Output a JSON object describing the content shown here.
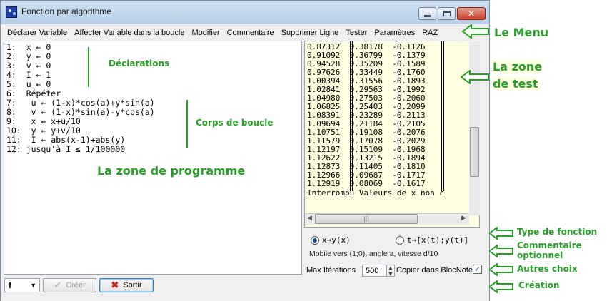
{
  "window": {
    "title": "Fonction par algorithme",
    "close_glyph": "✕"
  },
  "menu": [
    "Déclarer Variable",
    "Affecter Variable dans la boucle",
    "Modifier",
    "Commentaire",
    "Supprimer Ligne",
    "Tester",
    "Paramètres",
    "RAZ"
  ],
  "program": [
    "1:  x ← 0",
    "2:  y ← 0",
    "3:  v ← 0",
    "4:  I ← 1",
    "5:  u ← 0",
    "6:  Répéter",
    "7:   u ← (1-x)*cos(a)+y*sin(a)",
    "8:   v ← (1-x)*sin(a)-y*cos(a)",
    "9:   x ← x+u/10",
    "10:  y ← y+v/10",
    "11:  I ← abs(x-1)+abs(y)",
    "12: jusqu'à I ≤ 1/100000"
  ],
  "test_rows": [
    [
      "0.87312",
      "0.38178",
      "-0.1126"
    ],
    [
      "0.91092",
      "0.36799",
      "-0.1379"
    ],
    [
      "0.94528",
      "0.35209",
      "-0.1589"
    ],
    [
      "0.97626",
      "0.33449",
      "-0.1760"
    ],
    [
      "1.00394",
      "0.31556",
      "-0.1893"
    ],
    [
      "1.02841",
      "0.29563",
      "-0.1992"
    ],
    [
      "1.04980",
      "0.27503",
      "-0.2060"
    ],
    [
      "1.06825",
      "0.25403",
      "-0.2099"
    ],
    [
      "1.08391",
      "0.23289",
      "-0.2113"
    ],
    [
      "1.09694",
      "0.21184",
      "-0.2105"
    ],
    [
      "1.10751",
      "0.19108",
      "-0.2076"
    ],
    [
      "1.11579",
      "0.17078",
      "-0.2029"
    ],
    [
      "1.12197",
      "0.15109",
      "-0.1968"
    ],
    [
      "1.12622",
      "0.13215",
      "-0.1894"
    ],
    [
      "1.12873",
      "0.11405",
      "-0.1810"
    ],
    [
      "1.12966",
      "0.09687",
      "-0.1717"
    ],
    [
      "1.12919",
      "0.08069",
      "-0.1617"
    ]
  ],
  "test_status": "Interrompu Valeurs de x non c",
  "options": {
    "radio_xy": "x→y(x)",
    "radio_param": "t→[x(t);y(t)]",
    "radio_selected": "x→y(x)",
    "comment_value": "Mobile vers (1;0), angle a, vitesse d/10",
    "max_iter_label": "Max Itérations",
    "max_iter_value": "500",
    "copy_label": "Copier dans BlocNote",
    "copy_checked": "✓"
  },
  "footer": {
    "combo_value": "f",
    "create_label": "Créer",
    "exit_label": "Sortir"
  },
  "annotations": {
    "menu": "Le Menu",
    "test_zone_1": "La zone",
    "test_zone_2": "de test",
    "declarations": "Déclarations",
    "loop_body": "Corps de boucle",
    "program_zone": "La zone de programme",
    "function_type": "Type de fonction",
    "comment_1": "Commentaire",
    "comment_2": "optionnel",
    "other_choices": "Autres choix",
    "creation": "Création"
  },
  "colors": {
    "annotation": "#2aa02a",
    "test_background": "#ffffe1"
  }
}
